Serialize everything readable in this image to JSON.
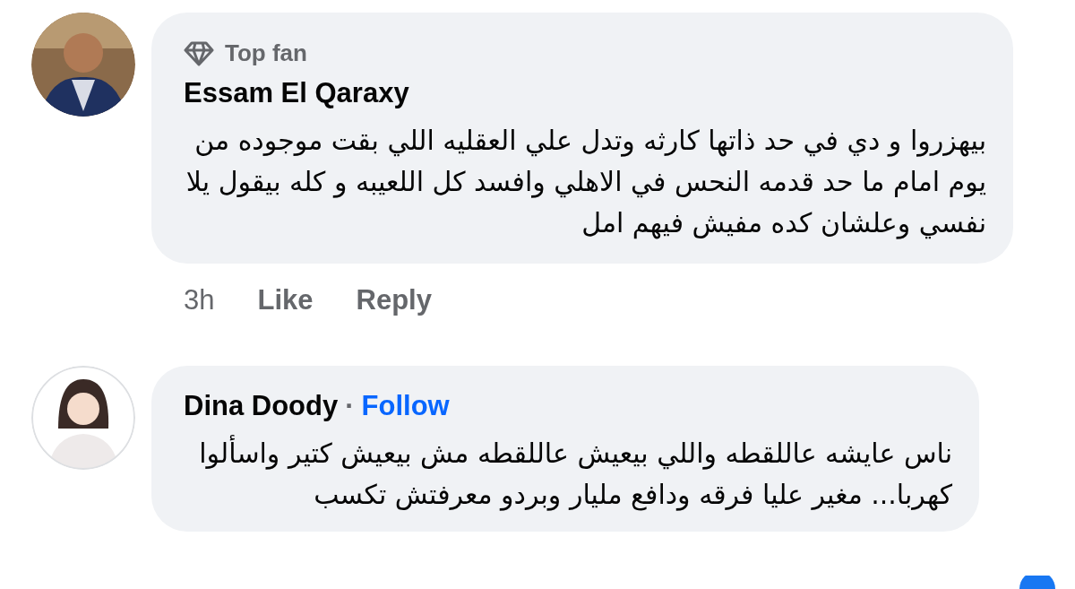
{
  "comments": [
    {
      "author": "Essam El Qaraxy",
      "badge": "Top fan",
      "text": "بيهزروا و دي في حد ذاتها كارثه وتدل علي العقليه اللي بقت موجوده من يوم امام ما حد قدمه النحس في الاهلي وافسد كل اللعيبه و كله بيقول يلا نفسي وعلشان كده مفيش فيهم امل",
      "time": "3h",
      "like": "Like",
      "reply": "Reply"
    },
    {
      "author": "Dina Doody",
      "separator": "·",
      "follow": "Follow",
      "text": "ناس عايشه عاللقطه واللي بيعيش عاللقطه مش بيعيش كتير واسألوا كهربا... مغير عليا فرقه ودافع مليار وبردو معرفتش تكسب"
    }
  ]
}
